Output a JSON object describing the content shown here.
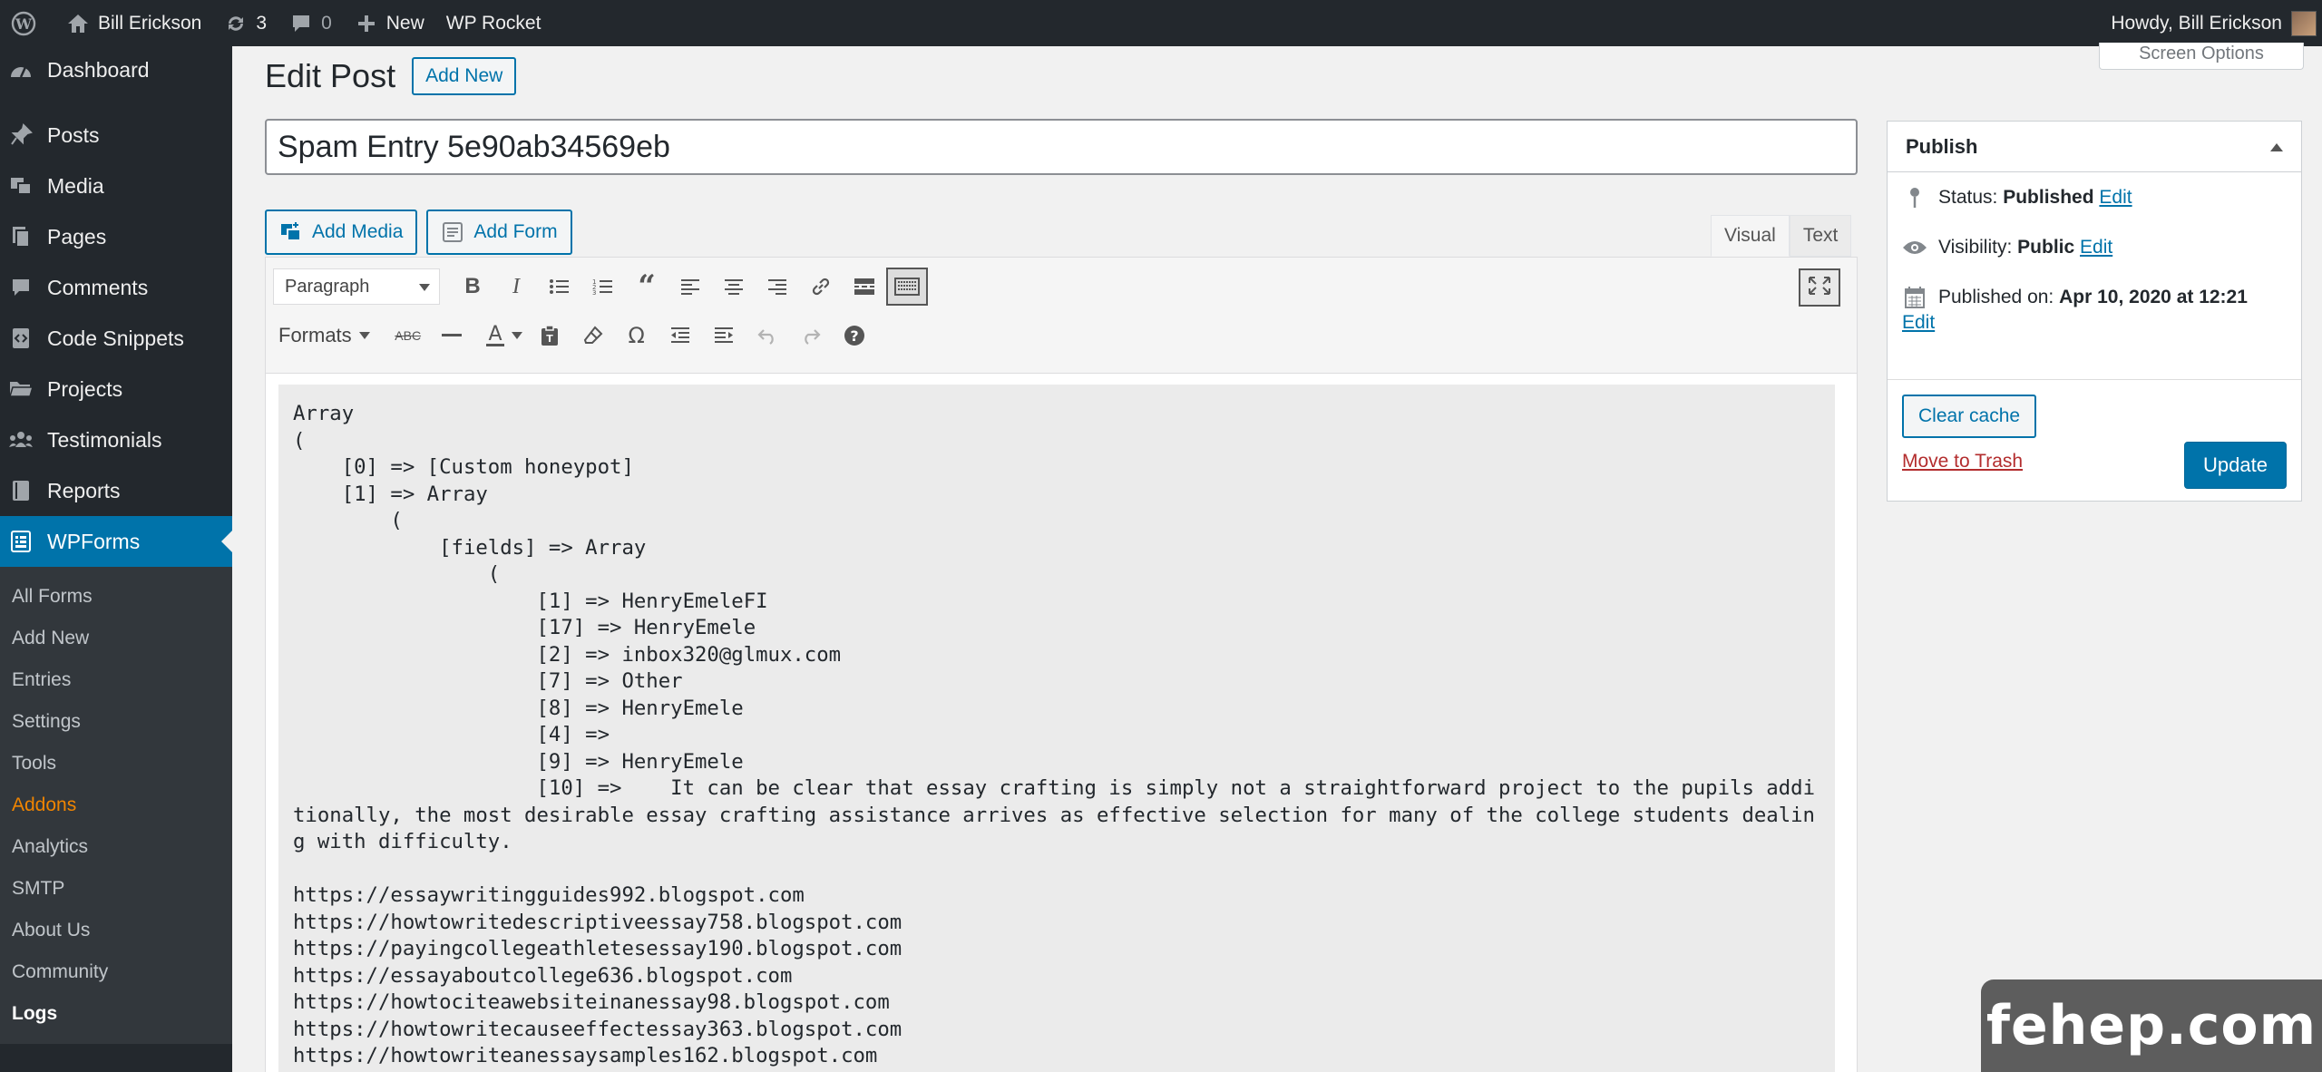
{
  "adminbar": {
    "site_name": "Bill Erickson",
    "updates_count": "3",
    "comments_count": "0",
    "new_label": "New",
    "wp_rocket_label": "WP Rocket",
    "howdy": "Howdy, Bill Erickson"
  },
  "sidebar": {
    "items": [
      {
        "label": "Dashboard",
        "icon": "dashboard-icon"
      },
      {
        "label": "Posts",
        "icon": "pin-icon"
      },
      {
        "label": "Media",
        "icon": "media-icon"
      },
      {
        "label": "Pages",
        "icon": "pages-icon"
      },
      {
        "label": "Comments",
        "icon": "comment-icon"
      },
      {
        "label": "Code Snippets",
        "icon": "code-icon"
      },
      {
        "label": "Projects",
        "icon": "folder-icon"
      },
      {
        "label": "Testimonials",
        "icon": "groups-icon"
      },
      {
        "label": "Reports",
        "icon": "book-icon"
      },
      {
        "label": "WPForms",
        "icon": "wpforms-icon"
      }
    ],
    "submenu": [
      "All Forms",
      "Add New",
      "Entries",
      "Settings",
      "Tools",
      "Addons",
      "Analytics",
      "SMTP",
      "About Us",
      "Community",
      "Logs"
    ]
  },
  "page": {
    "title": "Edit Post",
    "add_new": "Add New",
    "screen_options": "Screen Options",
    "post_title": "Spam Entry 5e90ab34569eb"
  },
  "editor": {
    "add_media": "Add Media",
    "add_form": "Add Form",
    "tab_visual": "Visual",
    "tab_text": "Text",
    "paragraph": "Paragraph",
    "formats": "Formats",
    "content": "Array\n(\n    [0] => [Custom honeypot]\n    [1] => Array\n        (\n            [fields] => Array\n                (\n                    [1] => HenryEmeleFI\n                    [17] => HenryEmele\n                    [2] => inbox320@glmux.com\n                    [7] => Other\n                    [8] => HenryEmele\n                    [4] => \n                    [9] => HenryEmele\n                    [10] =>    It can be clear that essay crafting is simply not a straightforward project to the pupils additionally, the most desirable essay crafting assistance arrives as effective selection for many of the college students dealing with difficulty.\n\nhttps://essaywritingguides992.blogspot.com\nhttps://howtowritedescriptiveessay758.blogspot.com\nhttps://payingcollegeathletesessay190.blogspot.com\nhttps://essayaboutcollege636.blogspot.com\nhttps://howtociteawebsiteinanessay98.blogspot.com\nhttps://howtowritecauseeffectessay363.blogspot.com\nhttps://howtowriteanessaysamples162.blogspot.com"
  },
  "publish": {
    "title": "Publish",
    "status_label": "Status:",
    "status_value": "Published",
    "visibility_label": "Visibility:",
    "visibility_value": "Public",
    "published_label": "Published on:",
    "published_value": "Apr 10, 2020 at 12:21",
    "edit": "Edit",
    "clear_cache": "Clear cache",
    "move_to_trash": "Move to Trash",
    "update": "Update"
  },
  "watermark": "fehep.com",
  "colors": {
    "accent": "#0073aa",
    "adminbar": "#23282d",
    "submenu_bg": "#32373c",
    "addons": "#f18500",
    "trash": "#b32d2e"
  }
}
